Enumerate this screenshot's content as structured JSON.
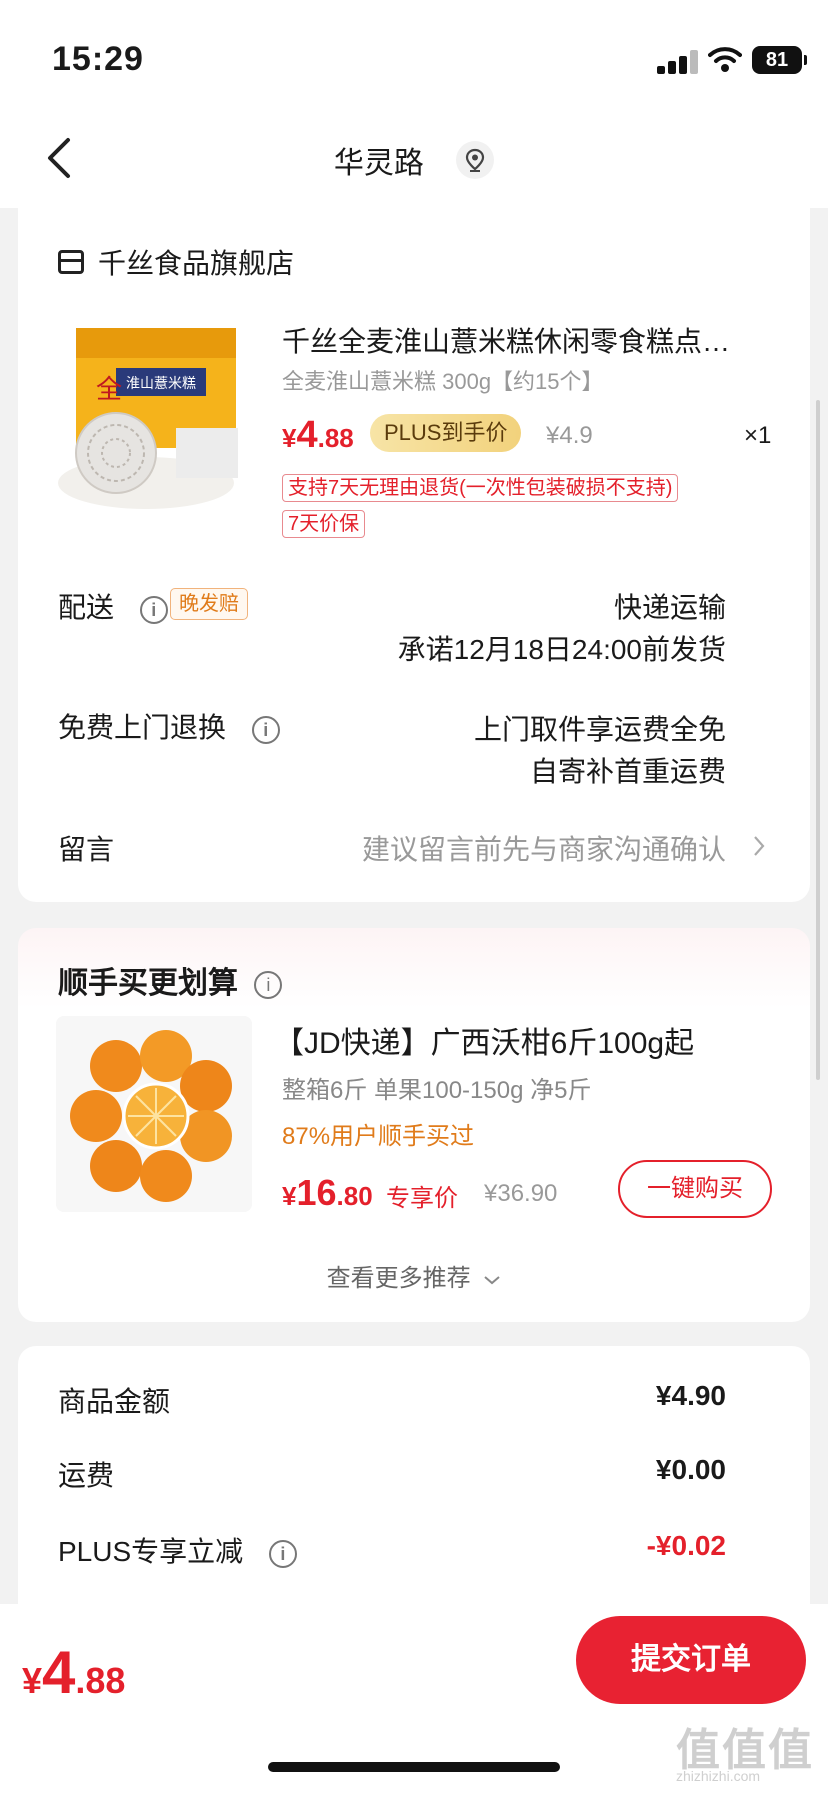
{
  "status_bar": {
    "time": "15:29",
    "battery": "81"
  },
  "nav": {
    "title": "华灵路"
  },
  "store": {
    "name": "千丝食品旗舰店"
  },
  "product": {
    "title": "千丝全麦淮山薏米糕休闲零食糕点…",
    "spec": "全麦淮山薏米糕 300g【约15个】",
    "price_symbol": "¥",
    "price_int": "4",
    "price_dec": ".88",
    "plus_tag": "PLUS到手价",
    "original_price": "¥4.9",
    "quantity": "×1",
    "tags": [
      "支持7天无理由退货(一次性包装破损不支持)",
      "7天价保"
    ]
  },
  "delivery": {
    "label": "配送",
    "tag": "晚发赔",
    "method": "快递运输",
    "promise": "承诺12月18日24:00前发货"
  },
  "returns": {
    "label": "免费上门退换",
    "line1": "上门取件享运费全免",
    "line2": "自寄补首重运费"
  },
  "message": {
    "label": "留言",
    "placeholder": "建议留言前先与商家沟通确认"
  },
  "upsell": {
    "title": "顺手买更划算",
    "product_title": "【JD快递】广西沃柑6斤100g起",
    "spec": "整箱6斤 单果100-150g 净5斤",
    "stat": "87%用户顺手买过",
    "price_symbol": "¥",
    "price_int": "16",
    "price_dec": ".80",
    "price_tag": "专享价",
    "original_price": "¥36.90",
    "buy_button": "一键购买",
    "more": "查看更多推荐"
  },
  "summary": {
    "rows": [
      {
        "label": "商品金额",
        "value": "¥4.90"
      },
      {
        "label": "运费",
        "value": "¥0.00"
      },
      {
        "label": "PLUS专享立减",
        "value": "-¥0.02"
      }
    ]
  },
  "footer": {
    "symbol": "¥",
    "total_int": "4",
    "total_dec": ".88",
    "submit": "提交订单"
  },
  "watermark": {
    "main": "值值值",
    "sub": "zhizhizhi.com"
  },
  "colors": {
    "accent": "#e4202b",
    "orange": "#e07b1a",
    "plus_gold": "#f2d27c"
  }
}
